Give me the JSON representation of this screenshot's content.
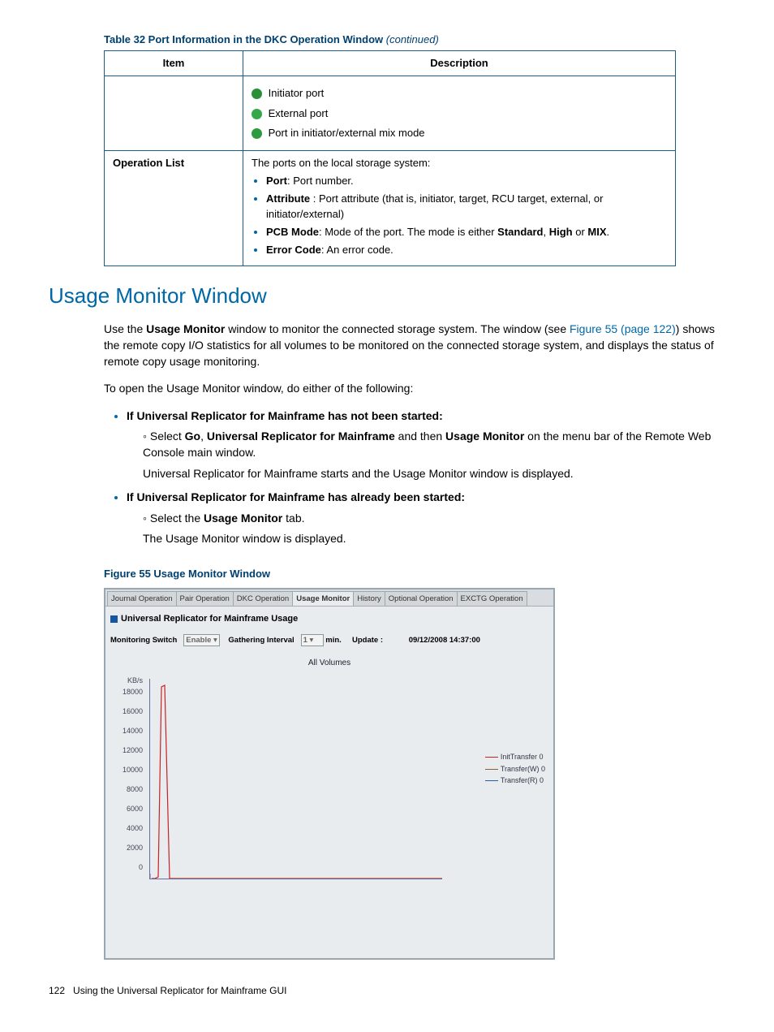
{
  "table": {
    "caption_prefix": "Table 32 Port Information in the DKC Operation Window ",
    "caption_suffix": "(continued)",
    "headers": {
      "item": "Item",
      "desc": "Description"
    },
    "row0": {
      "ports": {
        "initiator": "Initiator port",
        "external": "External port",
        "mix": "Port in initiator/external mix mode"
      }
    },
    "row1": {
      "item": "Operation List",
      "lead": "The ports on the local storage system:",
      "b1_label": "Port",
      "b1_text": ": Port number.",
      "b2_label": "Attribute ",
      "b2_text": ": Port attribute (that is, initiator, target, RCU target, external, or initiator/external)",
      "b3_label": "PCB Mode",
      "b3_text_a": ": Mode of the port. The mode is either ",
      "b3_std": "Standard",
      "b3_c1": ", ",
      "b3_high": "High",
      "b3_or": " or ",
      "b3_mix": "MIX",
      "b3_end": ".",
      "b4_label": "Error Code",
      "b4_text": ": An error code."
    }
  },
  "section_heading": "Usage Monitor Window",
  "para1_a": "Use the ",
  "para1_b": "Usage Monitor",
  "para1_c": " window to monitor the connected storage system. The window (see ",
  "para1_link": "Figure 55 (page 122)",
  "para1_d": ") shows the remote copy I/O statistics for all volumes to be monitored on the connected storage system, and displays the status of remote copy usage monitoring.",
  "para2": "To open the Usage Monitor window, do either of the following:",
  "case1_heading": "If Universal Replicator for Mainframe has not been started:",
  "case1_dir_a": "Select ",
  "case1_go": "Go",
  "case1_c1": ", ",
  "case1_urm": "Universal Replicator for Mainframe",
  "case1_and": " and then ",
  "case1_um": "Usage Monitor",
  "case1_dir_b": " on the menu bar of the Remote Web Console main window.",
  "case1_result": "Universal Replicator for Mainframe starts and the Usage Monitor window is displayed.",
  "case2_heading": "If Universal Replicator for Mainframe has already been started:",
  "case2_dir_a": "Select the ",
  "case2_um": "Usage Monitor",
  "case2_dir_b": " tab.",
  "case2_result": "The Usage Monitor window is displayed.",
  "figure_caption": "Figure 55 Usage Monitor Window",
  "window": {
    "tabs": {
      "journal": "Journal Operation",
      "pair": "Pair Operation",
      "dkc": "DKC Operation",
      "usage": "Usage Monitor",
      "history": "History",
      "optional": "Optional Operation",
      "exctg": "EXCTG Operation"
    },
    "title": "Universal Replicator for Mainframe Usage",
    "labels": {
      "mon_switch": "Monitoring Switch",
      "enable": "Enable",
      "gath": "Gathering Interval",
      "interval_val": "1",
      "min": "min.",
      "update": "Update :",
      "timestamp": "09/12/2008 14:37:00"
    },
    "chart_title": "All Volumes",
    "legend": {
      "a": "InitTransfer  0",
      "b": "Transfer(W)  0",
      "c": "Transfer(R)  0"
    }
  },
  "chart_data": {
    "type": "line",
    "title": "All Volumes",
    "ylabel": "KB/s",
    "xlabel": "",
    "ylim": [
      0,
      18000
    ],
    "y_ticks": [
      0,
      2000,
      4000,
      6000,
      8000,
      10000,
      12000,
      14000,
      16000,
      18000
    ],
    "series": [
      {
        "name": "InitTransfer",
        "color": "#c62323",
        "current": 0,
        "values": [
          0,
          17500,
          0,
          0,
          0,
          0,
          0,
          0,
          0,
          0,
          0,
          0,
          0,
          0,
          0,
          0,
          0,
          0,
          0,
          0
        ]
      },
      {
        "name": "Transfer(W)",
        "color": "#9a5c27",
        "current": 0,
        "values": [
          0,
          0,
          0,
          0,
          0,
          0,
          0,
          0,
          0,
          0,
          0,
          0,
          0,
          0,
          0,
          0,
          0,
          0,
          0,
          0
        ]
      },
      {
        "name": "Transfer(R)",
        "color": "#2c5aa0",
        "current": 0,
        "values": [
          0,
          0,
          0,
          0,
          0,
          0,
          0,
          0,
          0,
          0,
          0,
          0,
          0,
          0,
          0,
          0,
          0,
          0,
          0,
          0
        ]
      }
    ]
  },
  "footer_page": "122",
  "footer_text": "Using the Universal Replicator for Mainframe GUI"
}
